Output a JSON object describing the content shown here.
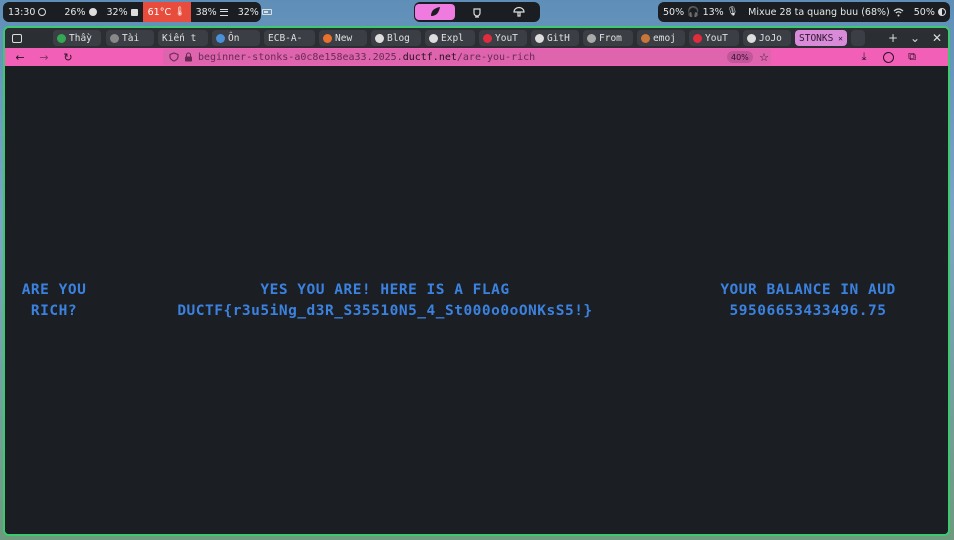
{
  "system_bar": {
    "time": "13:30",
    "cpu": "26%",
    "mem": "32%",
    "temp": "61°C",
    "disk": "38%",
    "battery": "32%",
    "volume": "50%",
    "headphones": "13%",
    "media": "Mixue 28 ta quang buu (68%)",
    "brightness": "50%"
  },
  "tabs": [
    {
      "label": "Thầy",
      "color": "#34a853"
    },
    {
      "label": "Tài",
      "color": "#888888"
    },
    {
      "label": "Kiến t",
      "color": ""
    },
    {
      "label": "Ôn",
      "color": "#4a90d9"
    },
    {
      "label": "ECB-A-",
      "color": ""
    },
    {
      "label": "New",
      "color": "#e8722c"
    },
    {
      "label": "Blog",
      "color": "#dddddd"
    },
    {
      "label": "Expl",
      "color": "#dddddd"
    },
    {
      "label": "YouT",
      "color": "#e02c3c"
    },
    {
      "label": "GitH",
      "color": "#dddddd"
    },
    {
      "label": "From",
      "color": "#aaaaaa"
    },
    {
      "label": "emoj",
      "color": "#c8763a"
    },
    {
      "label": "YouT",
      "color": "#e02c3c"
    },
    {
      "label": "JoJo",
      "color": "#dddddd"
    },
    {
      "label": "STONKS",
      "color": ""
    }
  ],
  "url": {
    "prefix": "beginner-stonks-a0c8e158ea33.2025.",
    "domain": "ductf.net",
    "path": "/are-you-rich"
  },
  "zoom": "40%",
  "page": {
    "left_line1": "ARE YOU",
    "left_line2": "RICH?",
    "mid_line1": "YES YOU ARE! HERE IS A FLAG",
    "mid_line2": "DUCTF{r3u5iNg_d3R_S35510N5_4_St000o0oONKsS5!}",
    "right_line1": "YOUR BALANCE IN AUD",
    "right_line2": "59506653433496.75"
  }
}
